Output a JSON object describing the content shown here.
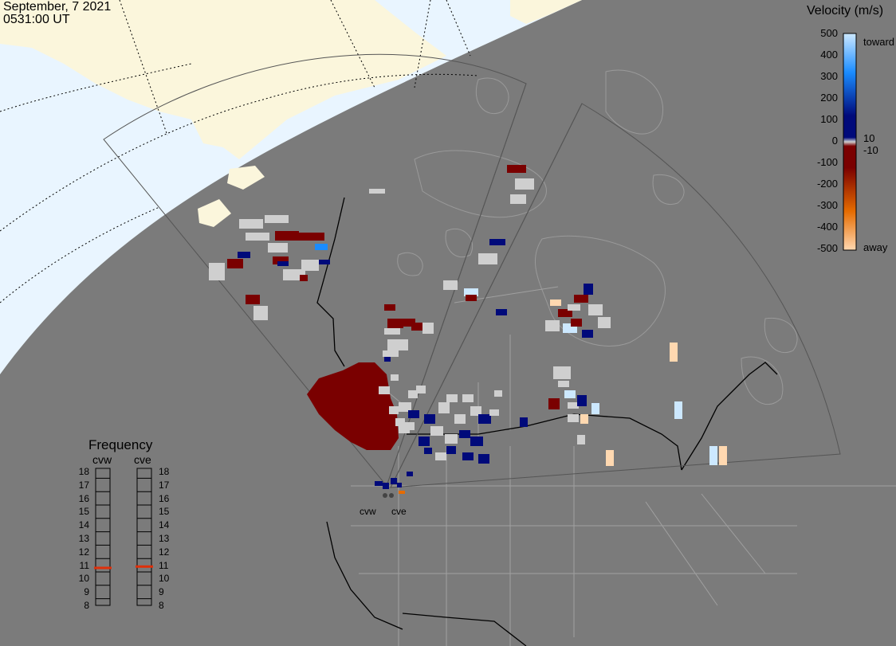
{
  "header": {
    "date": "September, 7 2021",
    "time": "0531:00 UT"
  },
  "colorbar": {
    "title": "Velocity (m/s)",
    "ticks": [
      "500",
      "400",
      "300",
      "200",
      "100",
      "0",
      "-100",
      "-200",
      "-300",
      "-400",
      "-500"
    ],
    "toward_label": "toward",
    "away_label": "away",
    "small_pos": "10",
    "small_neg": "-10",
    "colors": {
      "toward_light": "#cce8ff",
      "toward_mid": "#1a8cff",
      "toward_dark": "#000a7a",
      "away_dark": "#7a0000",
      "away_mid": "#e56b00",
      "away_light": "#ffd8b0",
      "ground_scatter": "#cfcfcf"
    }
  },
  "frequency": {
    "title": "Frequency",
    "radar_left": "cvw",
    "radar_right": "cve",
    "scale": [
      "18",
      "17",
      "16",
      "15",
      "14",
      "13",
      "12",
      "11",
      "10",
      "9",
      "8"
    ],
    "cvw_mhz": 10.8,
    "cve_mhz": 10.9
  },
  "radars": {
    "west_label": "cvw",
    "east_label": "cve"
  },
  "map_colors": {
    "daylight": "#e9f5ff",
    "land_day": "#fbf6dc",
    "night": "#7b7b7b",
    "coast_night": "#9a9a9a",
    "border": "#000000"
  }
}
